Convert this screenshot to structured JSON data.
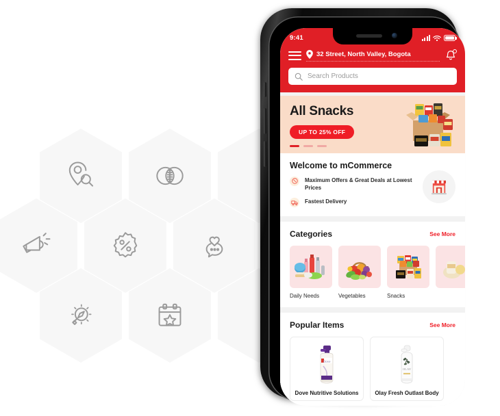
{
  "hive": {
    "hexagons": [
      {
        "name": "location-search-icon",
        "row": 1,
        "col": 1,
        "empty": false
      },
      {
        "name": "venn-circles-icon",
        "row": 1,
        "col": 2,
        "empty": false
      },
      {
        "name": "empty-hex-top-right",
        "row": 1,
        "col": 3,
        "empty": true
      },
      {
        "name": "megaphone-icon",
        "row": 2,
        "col": 0,
        "empty": false
      },
      {
        "name": "discount-badge-icon",
        "row": 2,
        "col": 1,
        "empty": false
      },
      {
        "name": "heart-chat-icon",
        "row": 2,
        "col": 2,
        "empty": false
      },
      {
        "name": "compass-search-icon",
        "row": 3,
        "col": 1,
        "empty": false
      },
      {
        "name": "calendar-star-icon",
        "row": 3,
        "col": 2,
        "empty": false
      },
      {
        "name": "empty-hex-bottom-right",
        "row": 3,
        "col": 3,
        "empty": true
      }
    ]
  },
  "phone": {
    "status": {
      "time": "9:41",
      "signal_icon": "cellular-bars-icon",
      "wifi_icon": "wifi-icon",
      "battery_icon": "battery-full-icon"
    },
    "header": {
      "menu_icon": "hamburger-menu-icon",
      "location_icon": "location-pin-icon",
      "address": "32 Street, North Valley, Bogota",
      "bell_icon": "notification-bell-icon",
      "has_notification": true
    },
    "search": {
      "placeholder": "Search Products",
      "icon": "search-icon"
    },
    "promo": {
      "title": "All Snacks",
      "button_label": "UP TO 25% OFF",
      "image_name": "snack-box-image",
      "dots": 3,
      "active_dot": 0
    },
    "welcome": {
      "title": "Welcome to mCommerce",
      "features": [
        {
          "icon": "offer-tag-icon",
          "text": "Maximum Offers & Great Deals at Lowest Prices"
        },
        {
          "icon": "delivery-truck-icon",
          "text": "Fastest Delivery"
        }
      ],
      "shop_icon": "storefront-icon"
    },
    "categories": {
      "title": "Categories",
      "see_more": "See More",
      "items": [
        {
          "name": "Daily Needs",
          "image_name": "daily-needs-image"
        },
        {
          "name": "Vegetables",
          "image_name": "vegetables-basket-image"
        },
        {
          "name": "Snacks",
          "image_name": "snacks-box-image"
        },
        {
          "name": "",
          "image_name": "partial-category-image"
        }
      ]
    },
    "popular": {
      "title": "Popular Items",
      "see_more": "See More",
      "items": [
        {
          "name": "Dove Nutritive Solutions",
          "image_name": "dove-bottle-image"
        },
        {
          "name": "Olay Fresh Outlast Body",
          "image_name": "olay-bottle-image"
        }
      ]
    }
  },
  "colors": {
    "brand_red": "#e01f26",
    "promo_bg": "#fadcc8",
    "hex_bg": "#f7f7f7",
    "icon_stroke": "#9a9a9a",
    "tile_pink": "#fbe3e4"
  }
}
